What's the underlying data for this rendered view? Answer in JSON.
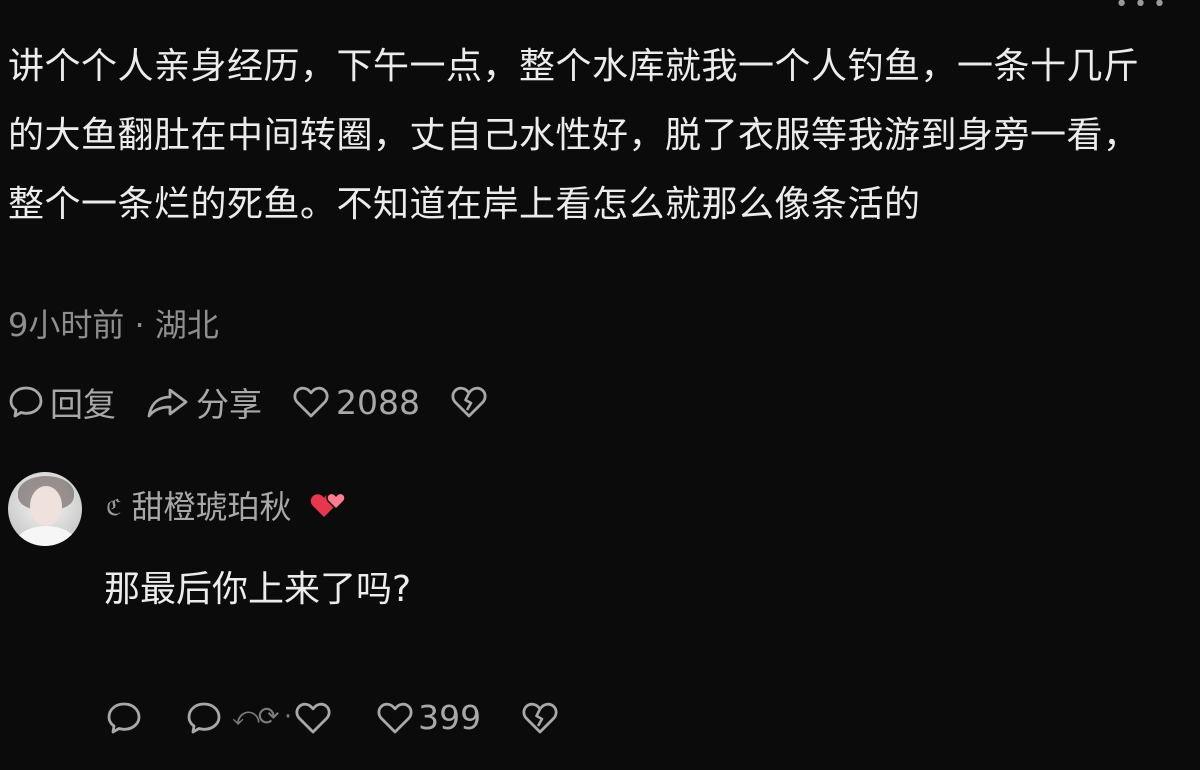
{
  "comment": {
    "text": "讲个个人亲身经历，下午一点，整个水库就我一个人钓鱼，一条十几斤的大鱼翻肚在中间转圈，丈自己水性好，脱了衣服等我游到身旁一看，整个一条烂的死鱼。不知道在岸上看怎么就那么像条活的",
    "meta": "9小时前 · 湖北",
    "actions": {
      "reply_label": "回复",
      "share_label": "分享",
      "like_count": "2088"
    }
  },
  "reply": {
    "username": "甜橙琥珀秋",
    "name_prefix": "ℭ",
    "text": "那最后你上来了吗?",
    "like_count": "399"
  },
  "icons": {
    "reply": "comment-bubble-icon",
    "share": "share-arrow-icon",
    "like": "heart-outline-icon",
    "dislike": "broken-heart-icon",
    "user_badge": "double-heart-icon"
  },
  "colors": {
    "background": "#0b0b0b",
    "text": "#ececec",
    "muted": "#a8a8a8",
    "badge_red": "#e8364f"
  }
}
